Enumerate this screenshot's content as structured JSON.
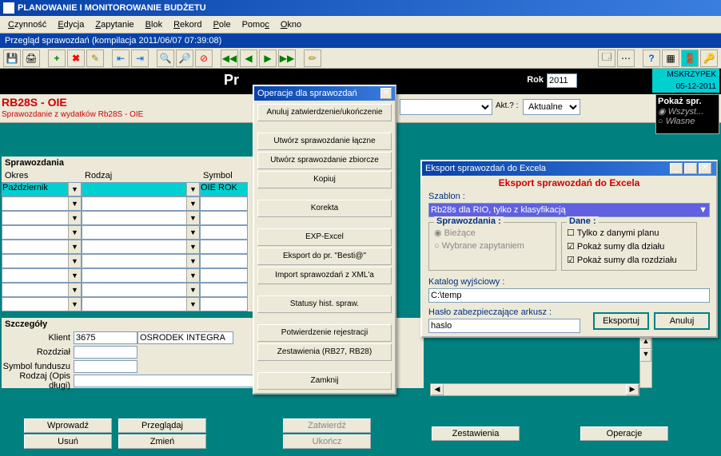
{
  "app_title": "PLANOWANIE I MONITOROWANIE BUDŻETU",
  "menu": {
    "czynnosc": "Czynność",
    "edycja": "Edycja",
    "zapytanie": "Zapytanie",
    "blok": "Blok",
    "rekord": "Rekord",
    "pole": "Pole",
    "pomoc": "Pomoc",
    "okno": "Okno"
  },
  "subtitle": "Przegląd sprawozdań (kompilacja 2011/06/07 07:39:08)",
  "header": {
    "pr": "Pr",
    "rok_label": "Rok",
    "rok_value": "2011",
    "user": "MSKRZYPEK",
    "date": "05-12-2011",
    "akt_label": "Akt.? :",
    "akt_value": "Aktualne"
  },
  "report": {
    "title": "RB28S - OIE",
    "subtitle": "Sprawozdanie z wydatków Rb28S - OIE"
  },
  "pokaz": {
    "title": "Pokaż spr.",
    "opt1": "Wszyst...",
    "opt2": "Własne"
  },
  "grid": {
    "title": "Sprawozdania",
    "col_okres": "Okres",
    "col_rodzaj": "Rodzaj",
    "col_symbol": "Symbol",
    "row0_okres": "Październik",
    "row0_symbol": "OIE ROK"
  },
  "szczegoly": {
    "title": "Szczegóły",
    "klient_label": "Klient",
    "klient_num": "3675",
    "klient_name": "OŚRODEK INTEGRA",
    "rozdzial_label": "Rozdział",
    "symbol_label": "Symbol funduszu",
    "rodzaj_label": "Rodzaj (Opis długi)"
  },
  "bottom": {
    "wprowadz": "Wprowadź",
    "usun": "Usuń",
    "przegladaj": "Przeglądaj",
    "zmien": "Zmień",
    "zatwierdz": "Zatwierdź",
    "ukoncz": "Ukończ",
    "zestawienia": "Zestawienia",
    "operacje": "Operacje"
  },
  "ops_modal": {
    "title": "Operacje dla sprawozdań",
    "b1": "Anuluj zatwierdzenie/ukończenie",
    "b2": "Utwórz sprawozdanie łączne",
    "b3": "Utwórz sprawozdanie zbiorcze",
    "b4": "Kopiuj",
    "b5": "Korekta",
    "b6": "EXP-Excel",
    "b7": "Eksport do pr. \"Besti@\"",
    "b8": "Import sprawozdań z XML'a",
    "b9": "Statusy hist. spraw.",
    "b10": "Potwierdzenie rejestracji",
    "b11": "Zestawienia (RB27, RB28)",
    "b12": "Zamknij"
  },
  "export_modal": {
    "title": "Eksport sprawozdań do Excela",
    "header": "Eksport sprawozdań do Excela",
    "szablon_label": "Szablon :",
    "szablon_value": "Rb28s dla RIO, tylko z klasyfikacją",
    "spr_legend": "Sprawozdania :",
    "spr_opt1": "Bieżące",
    "spr_opt2": "Wybrane zapytaniem",
    "dane_legend": "Dane :",
    "dane_opt1": "Tylko z danymi planu",
    "dane_opt2": "Pokaż sumy dla działu",
    "dane_opt3": "Pokaż sumy dla rozdziału",
    "katalog_label": "Katalog wyjściowy :",
    "katalog_value": "C:\\temp",
    "haslo_label": "Hasło zabezpieczające arkusz :",
    "haslo_value": "haslo",
    "eksportuj": "Eksportuj",
    "anuluj": "Anuluj"
  }
}
